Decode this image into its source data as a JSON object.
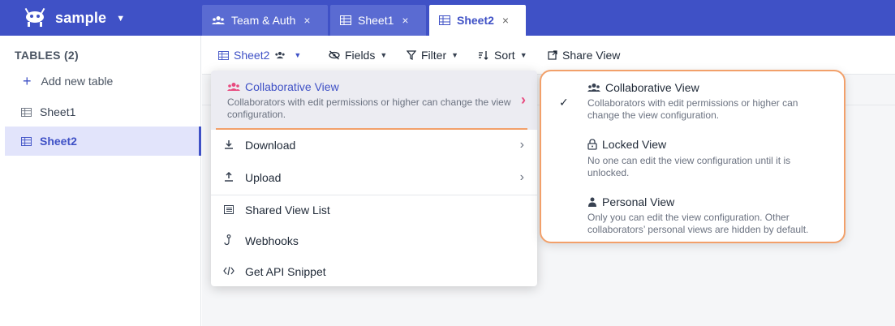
{
  "app": {
    "name": "sample"
  },
  "tabs": [
    {
      "label": "Team & Auth",
      "icon": "team-icon",
      "close": "×"
    },
    {
      "label": "Sheet1",
      "icon": "table-icon",
      "close": "×"
    },
    {
      "label": "Sheet2",
      "icon": "table-icon",
      "close": "×",
      "active": true
    }
  ],
  "sidebar": {
    "title": "TABLES (2)",
    "add_label": "Add new table",
    "items": [
      {
        "label": "Sheet1"
      },
      {
        "label": "Sheet2",
        "active": true
      }
    ]
  },
  "toolbar": {
    "view_label": "Sheet2",
    "fields_label": "Fields",
    "filter_label": "Filter",
    "sort_label": "Sort",
    "share_label": "Share View"
  },
  "menu": {
    "highlight": {
      "title": "Collaborative View",
      "desc": "Collaborators with edit permissions or higher can change the view configuration."
    },
    "items": [
      {
        "label": "Download",
        "icon": "download-icon"
      },
      {
        "label": "Upload",
        "icon": "upload-icon"
      },
      {
        "label": "Shared View List",
        "icon": "list-icon"
      },
      {
        "label": "Webhooks",
        "icon": "webhook-icon"
      },
      {
        "label": "Get API Snippet",
        "icon": "code-icon"
      }
    ]
  },
  "submenu": {
    "options": [
      {
        "title": "Collaborative View",
        "desc": "Collaborators with edit permissions or higher can change the view configuration.",
        "checked": true
      },
      {
        "title": "Locked View",
        "desc": "No one can edit the view configuration until it is unlocked."
      },
      {
        "title": "Personal View",
        "desc": "Only you can edit the view configuration. Other collaborators’ personal views are hidden by default."
      }
    ]
  },
  "colors": {
    "brand": "#3f51c6",
    "highlight_border": "#f2a06a",
    "chevron_accent": "#e84a7f"
  }
}
